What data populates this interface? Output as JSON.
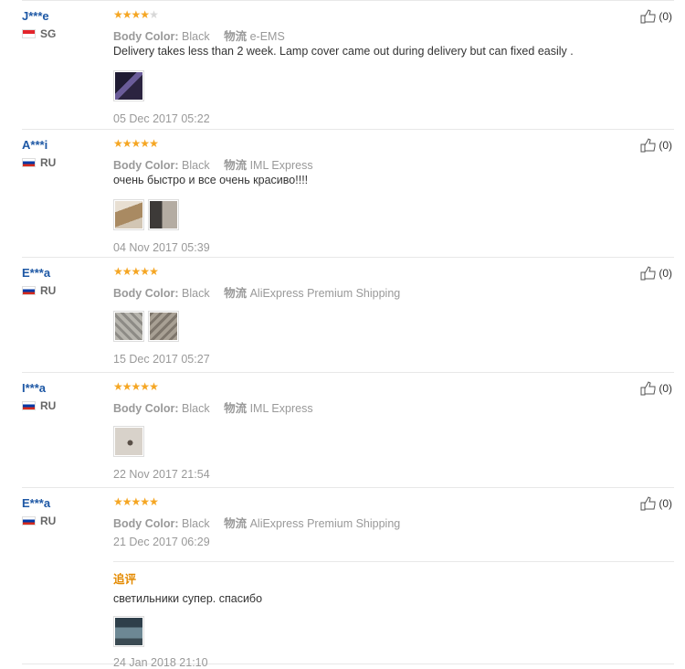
{
  "reviews": [
    {
      "user": "J***e",
      "country": "SG",
      "flag": "sg",
      "rating": 4,
      "color_label": "Body Color:",
      "color_value": "Black",
      "shipping_label": "物流",
      "shipping_value": "e-EMS",
      "text": "Delivery takes less than 2 week. Lamp cover came out during delivery but can fixed easily .",
      "date": "05 Dec 2017 05:22",
      "helpful": "(0)",
      "photos": [
        "#2b2440",
        "#514a63"
      ]
    },
    {
      "user": "A***i",
      "country": "RU",
      "flag": "ru",
      "rating": 5,
      "color_label": "Body Color:",
      "color_value": "Black",
      "shipping_label": "物流",
      "shipping_value": "IML Express",
      "text": "очень быстро и все очень красиво!!!!",
      "date": "04 Nov 2017 05:39",
      "helpful": "(0)",
      "photos": [
        "#b39a78",
        "#6e6862"
      ]
    },
    {
      "user": "E***a",
      "country": "RU",
      "flag": "ru",
      "rating": 5,
      "color_label": "Body Color:",
      "color_value": "Black",
      "shipping_label": "物流",
      "shipping_value": "AliExpress Premium Shipping",
      "text": "",
      "date": "15 Dec 2017 05:27",
      "helpful": "(0)",
      "photos": [
        "#a8a6a0",
        "#968e82"
      ]
    },
    {
      "user": "I***a",
      "country": "RU",
      "flag": "ru",
      "rating": 5,
      "color_label": "Body Color:",
      "color_value": "Black",
      "shipping_label": "物流",
      "shipping_value": "IML Express",
      "text": "",
      "date": "22 Nov 2017 21:54",
      "helpful": "(0)",
      "photos": [
        "#c9c3bb"
      ]
    },
    {
      "user": "E***a",
      "country": "RU",
      "flag": "ru",
      "rating": 5,
      "color_label": "Body Color:",
      "color_value": "Black",
      "shipping_label": "物流",
      "shipping_value": "AliExpress Premium Shipping",
      "text": "",
      "date": "21 Dec 2017 06:29",
      "helpful": "(0)",
      "photos": [],
      "followup": {
        "label": "追评",
        "text": "светильники супер. спасибо",
        "photos": [
          "#4d6470"
        ],
        "date": "24 Jan 2018 21:10"
      }
    }
  ]
}
